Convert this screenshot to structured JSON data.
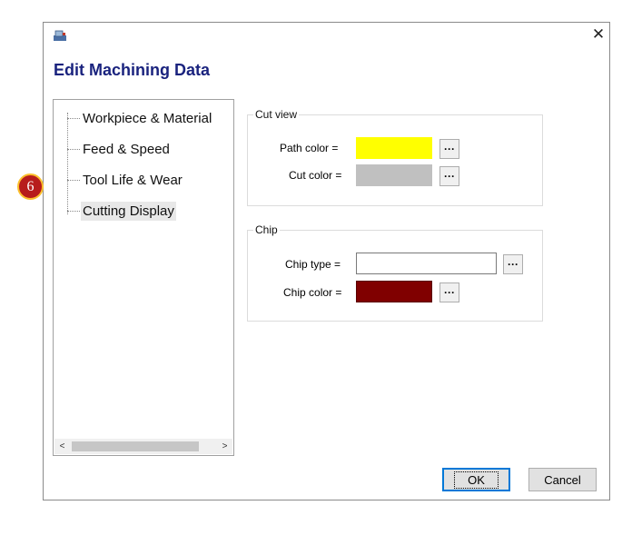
{
  "dialog": {
    "heading": "Edit Machining Data",
    "close_symbol": "✕"
  },
  "tree": {
    "items": [
      {
        "label": "Workpiece & Material"
      },
      {
        "label": "Feed & Speed"
      },
      {
        "label": "Tool Life & Wear"
      },
      {
        "label": "Cutting Display",
        "selected": true
      }
    ],
    "scroll_left": "<",
    "scroll_right": ">"
  },
  "cut_view": {
    "title": "Cut view",
    "path_color_label": "Path color =",
    "path_color": "#ffff00",
    "cut_color_label": "Cut color =",
    "cut_color": "#c0c0c0"
  },
  "chip": {
    "title": "Chip",
    "chip_type_label": "Chip type =",
    "chip_type_value": "",
    "chip_color_label": "Chip color =",
    "chip_color": "#800000"
  },
  "browse_label": "···",
  "buttons": {
    "ok": "OK",
    "cancel": "Cancel"
  },
  "marker": {
    "number": "6"
  },
  "colors": {
    "accent": "#0078d7",
    "heading": "#1a237e",
    "marker_fill": "#b71c1c",
    "marker_border": "#fbc02d"
  }
}
